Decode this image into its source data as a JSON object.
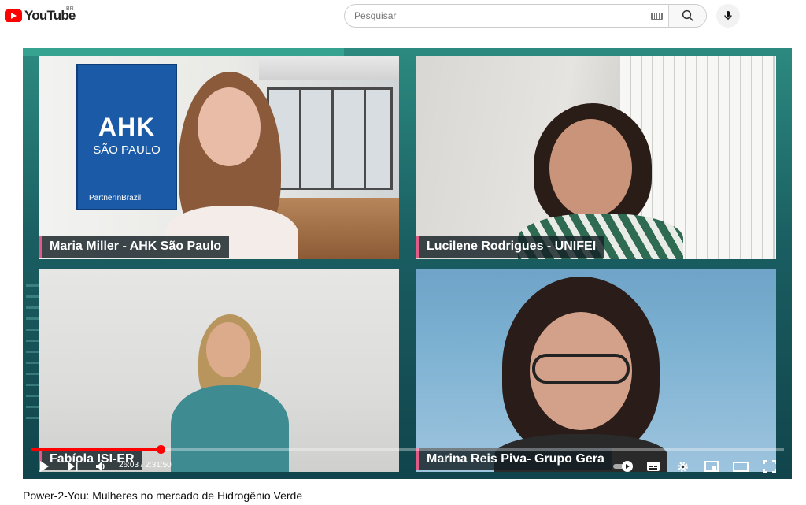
{
  "header": {
    "logo_text": "YouTube",
    "region": "BR",
    "search_placeholder": "Pesquisar"
  },
  "video": {
    "ahk_banner": {
      "line1": "AHK",
      "line2": "SÃO PAULO",
      "partner": "PartnerInBrazil"
    },
    "participants": [
      {
        "name": "Maria Miller - AHK São Paulo"
      },
      {
        "name": "Lucilene Rodrigues - UNIFEI"
      },
      {
        "name": "Fabíola ISI-ER"
      },
      {
        "name": "Marina Reis Piva- Grupo Gera"
      }
    ],
    "player": {
      "current_time": "26:03",
      "separator": " / ",
      "duration": "2:31:50",
      "progress_fraction": 0.172
    },
    "title": "Power-2-You: Mulheres no mercado de Hidrogênio Verde"
  },
  "colors": {
    "brand_red": "#ff0000",
    "nameplate_accent": "#e25b86"
  },
  "icons": [
    "youtube-logo-icon",
    "keyboard-icon",
    "search-icon",
    "mic-icon",
    "play-icon",
    "next-icon",
    "volume-icon",
    "autoplay-toggle-icon",
    "subtitles-icon",
    "settings-icon",
    "miniplayer-icon",
    "theater-icon",
    "fullscreen-icon"
  ]
}
